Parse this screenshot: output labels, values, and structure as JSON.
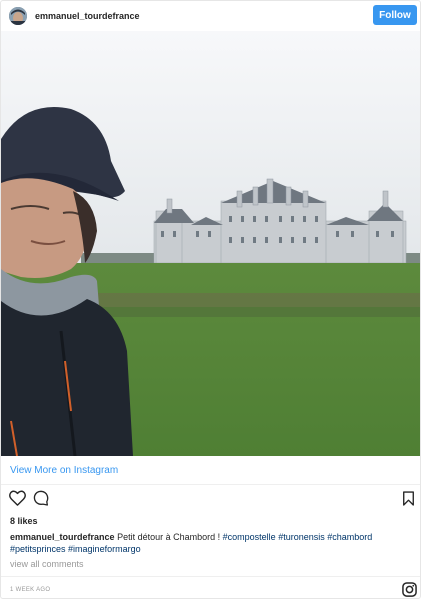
{
  "header": {
    "username": "emmanuel_tourdefrance",
    "follow_label": "Follow"
  },
  "post": {
    "view_more_label": "View More on Instagram",
    "likes": "8 likes",
    "caption_user": "emmanuel_tourdefrance",
    "caption_text": "Petit détour à Chambord !",
    "hashtags": [
      "#compostelle",
      "#turonensis",
      "#chambord",
      "#petitsprinces",
      "#imagineformargo"
    ],
    "view_comments_label": "view all comments",
    "timestamp": "1 WEEK AGO"
  },
  "icons": {
    "like": "heart-icon",
    "comment": "comment-icon",
    "save": "bookmark-icon",
    "brand": "instagram-logo-icon"
  },
  "colors": {
    "accent": "#3897f0",
    "hashtag": "#003569",
    "muted": "#999999"
  }
}
